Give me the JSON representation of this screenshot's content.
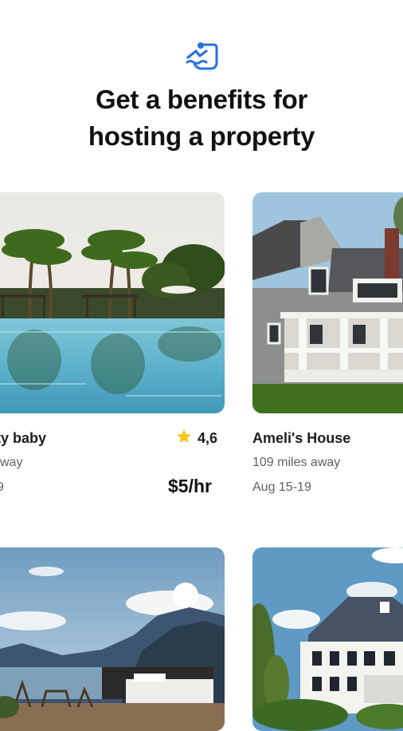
{
  "header": {
    "icon": "swim-logo-icon",
    "title_line1": "Get a benefits for",
    "title_line2": "hosting a property"
  },
  "listings": [
    {
      "title": "ty baby",
      "distance": "way",
      "dates": "9",
      "rating": "4,6",
      "price": "$5/hr"
    },
    {
      "title": "Ameli's House",
      "distance": "109 miles away",
      "dates": "Aug 15-19"
    },
    {},
    {}
  ],
  "colors": {
    "accent": "#2b6fe0",
    "star": "#f5c518"
  }
}
